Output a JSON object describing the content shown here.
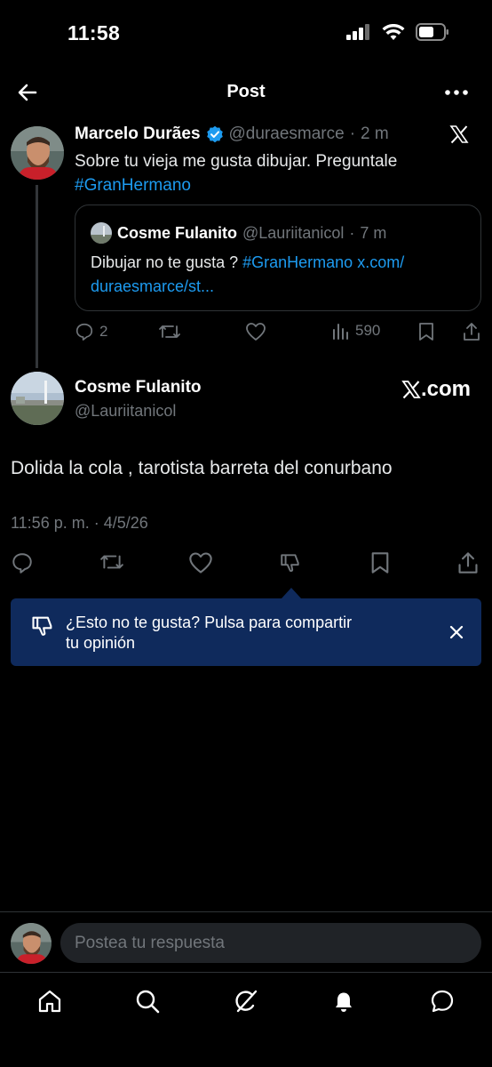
{
  "status_bar": {
    "time": "11:58",
    "icons": [
      "signal-icon",
      "wifi-icon",
      "battery-icon"
    ]
  },
  "header": {
    "title": "Post",
    "back_icon": "back-arrow-icon",
    "more_icon": "more-icon"
  },
  "parent_post": {
    "author_name": "Marcelo Durães",
    "verified": true,
    "handle": "@duraesmarce",
    "separator": "·",
    "time": "2 m",
    "text": "Sobre tu vieja me gusta dibujar. Preguntale",
    "hashtag": "#GranHermano",
    "quote": {
      "author_name": "Cosme Fulanito",
      "handle": "@Lauriitanicol",
      "separator": "·",
      "time": "7 m",
      "text": "Dibujar no te gusta ?",
      "hashtag": "#GranHermano",
      "link_line1": "x.com/",
      "link_line2": "duraesmarce/st..."
    },
    "actions": {
      "replies": "2",
      "reposts": "",
      "likes": "",
      "views": "590"
    }
  },
  "main_post": {
    "author_name": "Cosme Fulanito",
    "handle": "@Lauriitanicol",
    "watermark": ".com",
    "text": "Dolida la cola , tarotista barreta del conurbano",
    "timestamp": "11:56 p. m. · 4/5/26"
  },
  "dislike_tooltip": {
    "text_line1": "¿Esto no te gusta? Pulsa para compartir",
    "text_line2": "tu opinión"
  },
  "composer": {
    "placeholder": "Postea tu respuesta"
  },
  "bottom_nav": [
    "home-icon",
    "search-icon",
    "grok-icon",
    "notifications-icon",
    "messages-icon"
  ],
  "colors": {
    "background": "#000000",
    "accent": "#1d9bf0",
    "muted": "#71767b",
    "tooltip": "#0f2a5c"
  }
}
